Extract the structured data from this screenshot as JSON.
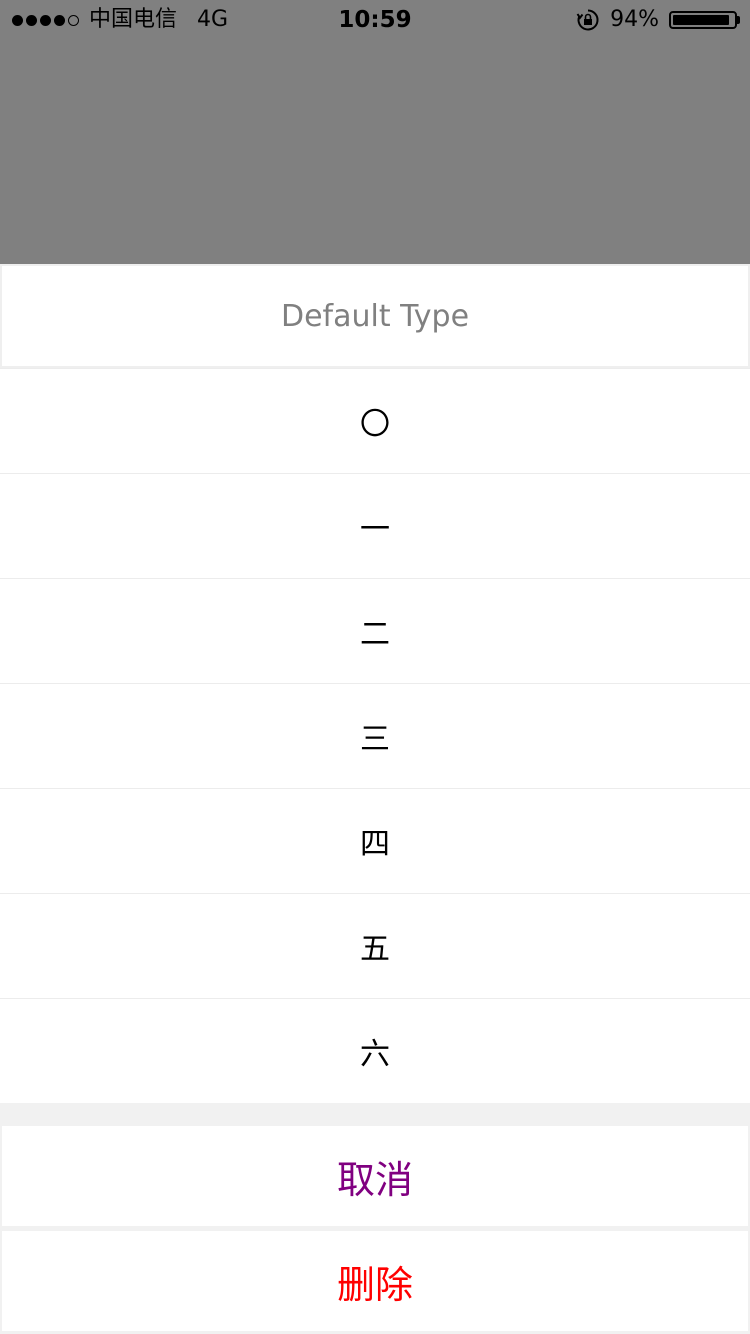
{
  "status_bar": {
    "signal_icon": "cell-signal-4-of-5",
    "carrier": "中国电信",
    "network": "4G",
    "time": "10:59",
    "rotation_lock_icon": "rotation-lock-icon",
    "battery_percent": "94%",
    "battery_level": 0.94
  },
  "sheet": {
    "title": "Default Type",
    "options": [
      "〇",
      "一",
      "二",
      "三",
      "四",
      "五",
      "六"
    ],
    "cancel_label": "取消",
    "delete_label": "删除"
  },
  "colors": {
    "overlay": "#808080",
    "title_text": "#808080",
    "cancel_text": "#800080",
    "delete_text": "#ff0000",
    "separator_background": "#f1f1f1"
  }
}
